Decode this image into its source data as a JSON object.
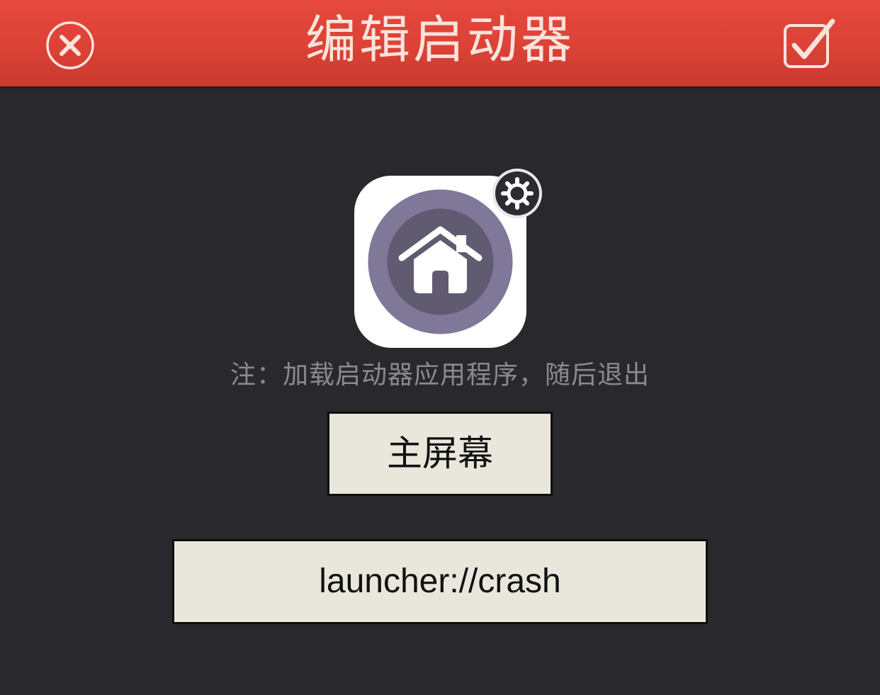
{
  "header": {
    "title": "编辑启动器",
    "close_icon": "close-circle-icon",
    "confirm_icon": "checkbox-check-icon",
    "background_color": "#dc4236"
  },
  "launcher": {
    "icon": "home-icon",
    "settings_icon": "gear-icon",
    "note": "注：加载启动器应用程序，随后退出",
    "name_button_label": "主屏幕",
    "url_button_label": "launcher://crash"
  },
  "colors": {
    "background": "#29282d",
    "button_fill": "#e9e7dc",
    "icon_ring": "#7f7899",
    "icon_disc": "#605b70"
  }
}
